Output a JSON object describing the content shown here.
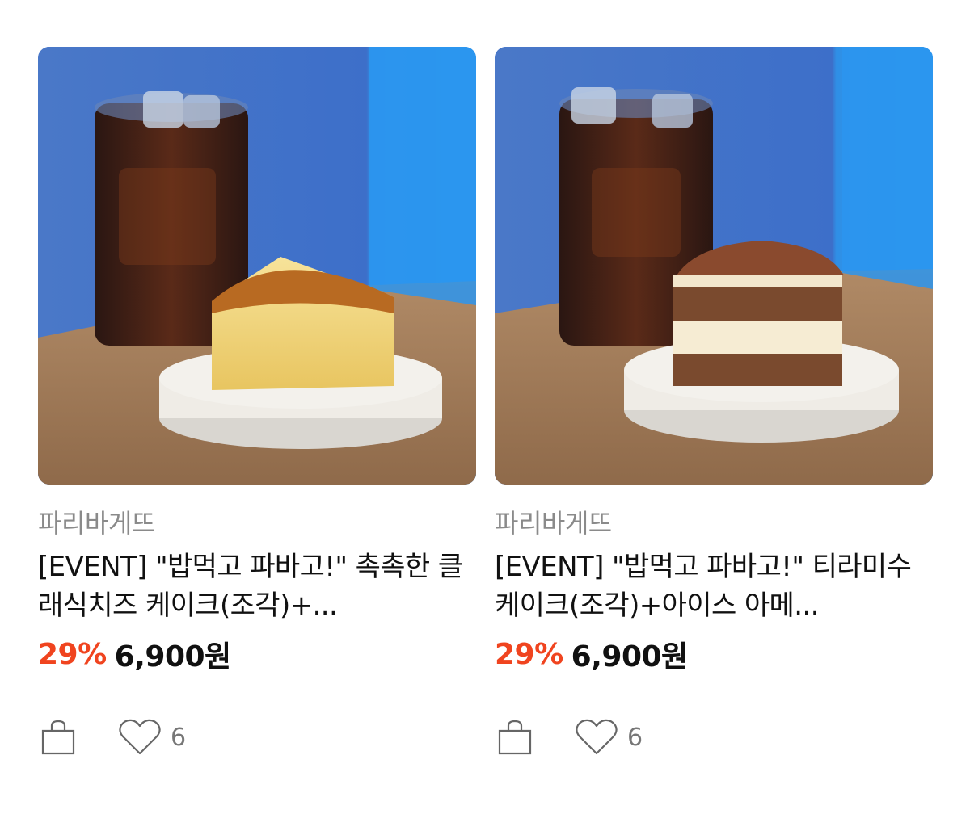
{
  "products": [
    {
      "brand": "파리바게뜨",
      "title": "[EVENT] \"밥먹고 파바고!\" 촉촉한 클래식치즈 케이크(조각)+...",
      "discount": "29%",
      "price": "6,900",
      "currency": "원",
      "like_count": "6",
      "image": "iced-americano-cheesecake-photo"
    },
    {
      "brand": "파리바게뜨",
      "title": "[EVENT] \"밥먹고 파바고!\" 티라미수케이크(조각)+아이스 아메...",
      "discount": "29%",
      "price": "6,900",
      "currency": "원",
      "like_count": "6",
      "image": "iced-americano-tiramisu-photo"
    }
  ],
  "icons": {
    "cart": "shopping-bag-icon",
    "like": "heart-icon"
  },
  "colors": {
    "discount": "#f0441f",
    "brand_text": "#8a8a8a"
  }
}
